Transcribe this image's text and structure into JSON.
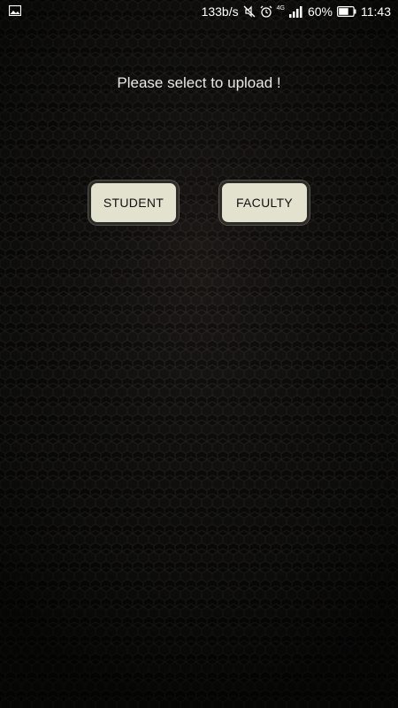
{
  "status_bar": {
    "left_icon": "image-icon",
    "speed": "133b/s",
    "network": "4G",
    "battery_percent": "60%",
    "time": "11:43",
    "icons": [
      "mute-icon",
      "alarm-icon",
      "signal-icon",
      "battery-icon"
    ]
  },
  "main": {
    "prompt": "Please select to upload !",
    "student_label": "STUDENT",
    "faculty_label": "FACULTY"
  },
  "colors": {
    "background": "#0c0c0b",
    "button_bg": "#e3e2cf",
    "prompt_text": "#e8e8e8"
  }
}
